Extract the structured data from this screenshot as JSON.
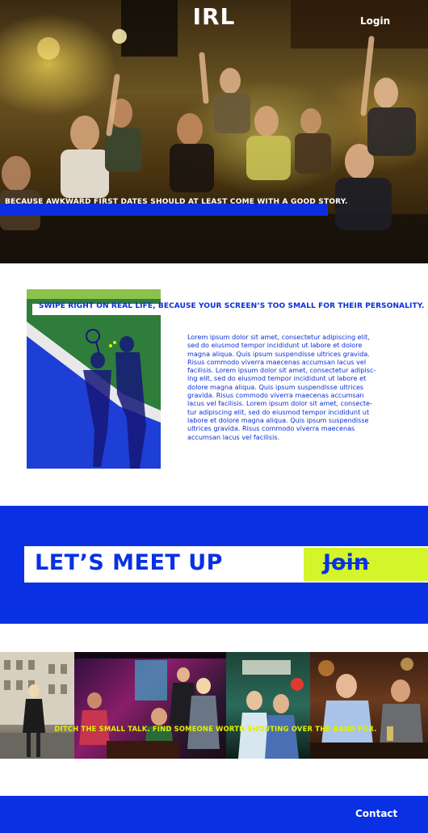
{
  "header": {
    "brand": "IRL",
    "login_label": "Login"
  },
  "hero": {
    "tagline": "BECAUSE AWKWARD FIRST DATES SHOULD AT LEAST COME WITH A GOOD STORY."
  },
  "intro": {
    "headline": "SWIPE RIGHT ON REAL LIFE, BECAUSE YOUR SCREEN’S TOO SMALL FOR THEIR PERSONALITY.",
    "body_lines": [
      "Lorem ipsum dolor sit amet, consectetur adipiscing elit,",
      "sed do eiusmod tempor incididunt ut labore et dolore",
      "magna aliqua. Quis ipsum suspendisse ultrices gravida.",
      "Risus commodo viverra maecenas accumsan lacus vel",
      "facilisis. Lorem ipsum dolor sit amet, consectetur adipisc-",
      "ing elit, sed do eiusmod tempor incididunt ut labore et",
      "dolore magna aliqua. Quis ipsum suspendisse ultrices",
      "gravida. Risus commodo viverra maecenas accumsan",
      "lacus vel facilisis. Lorem ipsum dolor sit amet, consecte-",
      "tur adipiscing elit, sed do eiusmod tempor incididunt ut",
      "labore et dolore magna aliqua. Quis ipsum suspendisse",
      "ultrices gravida. Risus commodo viverra maecenas",
      "accumsan lacus vel facilisis."
    ]
  },
  "cta": {
    "title": "LET’S MEET UP",
    "join_label": "Join"
  },
  "strip": {
    "caption": "DITCH THE SMALL TALK. FIND SOMEONE WORTH SHOUTING OVER THE BAND FOR."
  },
  "footer": {
    "contact_label": "Contact"
  },
  "colors": {
    "brand_blue": "#0931e3",
    "accent_lime": "#d4f52a",
    "text_blue": "#0a2ed8"
  }
}
